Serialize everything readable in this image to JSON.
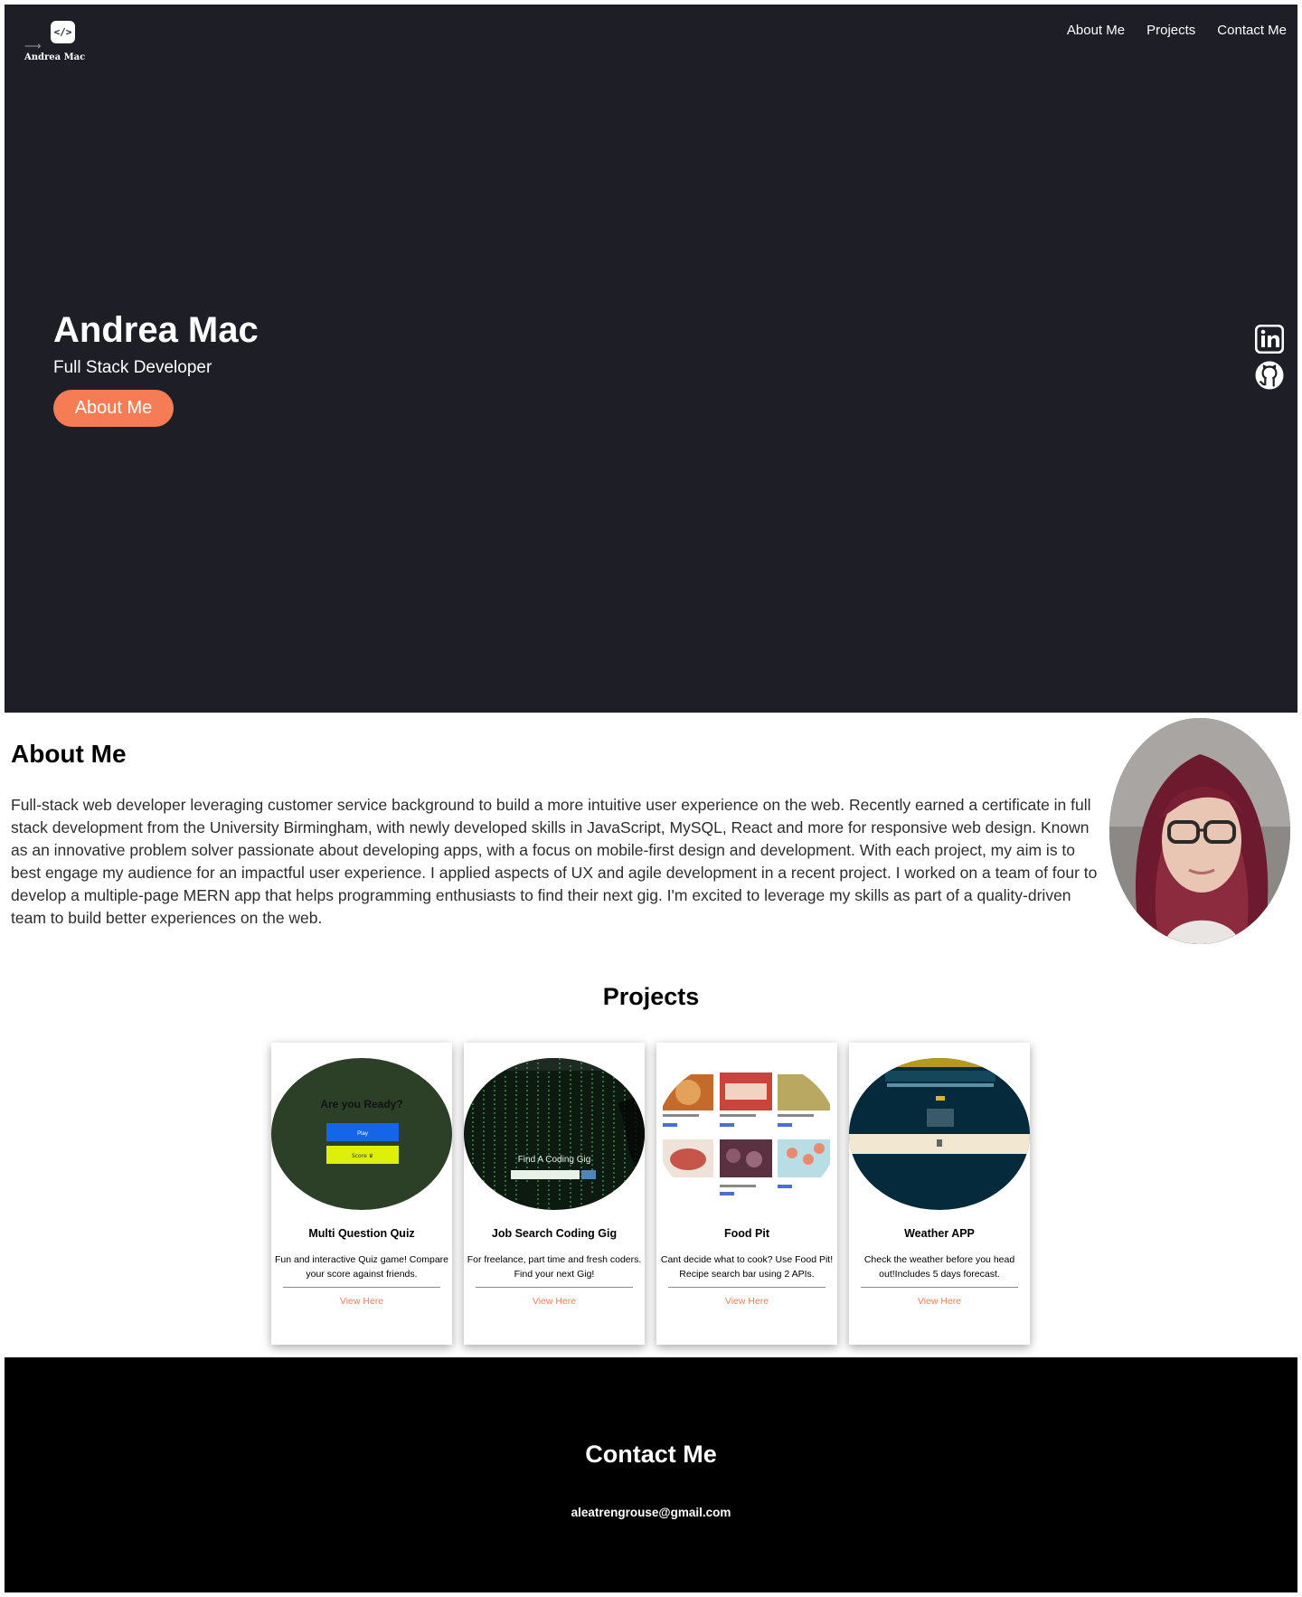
{
  "brand": {
    "name": "Andrea Mac",
    "logo_glyph": "</>"
  },
  "nav": {
    "items": [
      "About Me",
      "Projects",
      "Contact Me"
    ]
  },
  "hero": {
    "name": "Andrea Mac",
    "role": "Full Stack Developer",
    "button_label": "About Me",
    "accent_color": "#f57c55",
    "background_color": "#1d1e26",
    "social_icons": [
      "linkedin-icon",
      "github-icon"
    ]
  },
  "about": {
    "title": "About Me",
    "text": "Full-stack web developer leveraging customer service background to build a more intuitive user experience on the web. Recently earned a certificate in full stack development from the University Birmingham, with newly developed skills in JavaScript, MySQL, React and more for responsive web design. Known as an innovative problem solver passionate about developing apps, with a focus on mobile-first design and development. With each project, my aim is to best engage my audience for an impactful user experience. I applied aspects of UX and agile development in a recent project. I worked on a team of four to develop a multiple-page MERN app that helps programming enthusiasts to find their next gig. I'm excited to leverage my skills as part of a quality-driven team to build better experiences on the web."
  },
  "projects": {
    "title": "Projects",
    "items": [
      {
        "title": "Multi Question Quiz",
        "description": "Fun and interactive Quiz game! Compare your score against friends.",
        "link": "View Here",
        "thumb": {
          "heading": "Are you Ready?",
          "buttons": [
            "Play",
            "Score ♛"
          ]
        }
      },
      {
        "title": "Job Search Coding Gig",
        "description": "For freelance, part time and fresh coders. Find your next Gig!",
        "link": "View Here",
        "thumb": {
          "heading": "Find A Coding Gig"
        }
      },
      {
        "title": "Food Pit",
        "description": "Cant decide what to cook? Use Food Pit! Recipe search bar using 2 APIs.",
        "link": "View Here"
      },
      {
        "title": "Weather APP",
        "description": "Check the weather before you head out!Includes 5 days forecast.",
        "link": "View Here"
      }
    ]
  },
  "contact": {
    "title": "Contact Me",
    "email": "aleatrengrouse@gmail.com"
  }
}
